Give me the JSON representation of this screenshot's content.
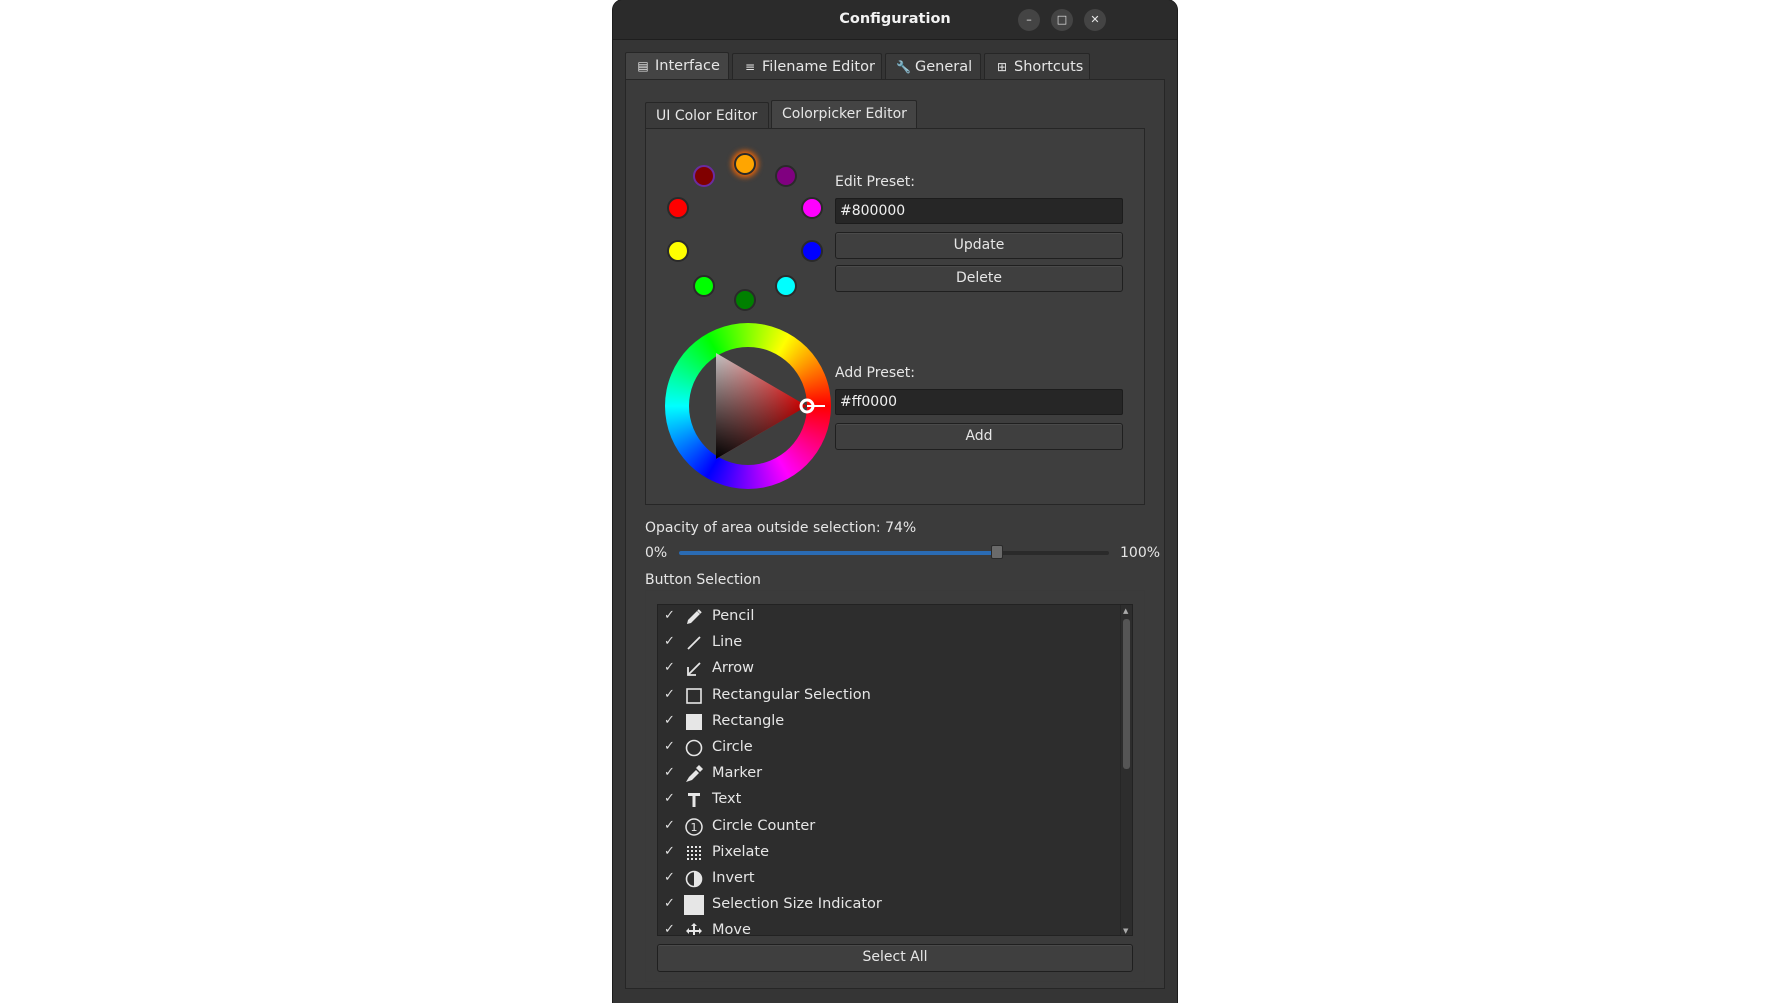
{
  "window": {
    "title": "Configuration",
    "controls": {
      "minimize": "–",
      "maximize": "□",
      "close": "✕"
    }
  },
  "tabs": [
    {
      "label": "Interface",
      "icon": "interface-icon",
      "active": true
    },
    {
      "label": "Filename Editor",
      "icon": "filename-icon",
      "active": false
    },
    {
      "label": "General",
      "icon": "wrench-icon",
      "active": false
    },
    {
      "label": "Shortcuts",
      "icon": "grid-icon",
      "active": false
    }
  ],
  "subtabs": [
    {
      "label": "UI Color Editor",
      "active": false
    },
    {
      "label": "Colorpicker Editor",
      "active": true
    }
  ],
  "colorpicker": {
    "presets": [
      "#ffa500",
      "#800080",
      "#ff00ff",
      "#0000ff",
      "#00ffff",
      "#008000",
      "#00ff00",
      "#ffff00",
      "#ff0000",
      "#800000"
    ],
    "selected_preset": "#800000",
    "edit_label": "Edit Preset:",
    "edit_value": "#800000",
    "update_label": "Update",
    "delete_label": "Delete",
    "add_label": "Add Preset:",
    "add_value": "#ff0000",
    "add_button": "Add"
  },
  "opacity": {
    "label": "Opacity of area outside selection: 74%",
    "min_label": "0%",
    "max_label": "100%",
    "value": 74
  },
  "button_selection": {
    "label": "Button Selection",
    "items": [
      {
        "label": "Pencil",
        "icon": "pencil-icon",
        "checked": true
      },
      {
        "label": "Line",
        "icon": "line-icon",
        "checked": true
      },
      {
        "label": "Arrow",
        "icon": "arrow-icon",
        "checked": true
      },
      {
        "label": "Rectangular Selection",
        "icon": "rect-selection-icon",
        "checked": true
      },
      {
        "label": "Rectangle",
        "icon": "rectangle-icon",
        "checked": true
      },
      {
        "label": "Circle",
        "icon": "circle-icon",
        "checked": true
      },
      {
        "label": "Marker",
        "icon": "marker-icon",
        "checked": true
      },
      {
        "label": "Text",
        "icon": "text-icon",
        "checked": true
      },
      {
        "label": "Circle Counter",
        "icon": "circle-counter-icon",
        "checked": true
      },
      {
        "label": "Pixelate",
        "icon": "pixelate-icon",
        "checked": true
      },
      {
        "label": "Invert",
        "icon": "invert-icon",
        "checked": true
      },
      {
        "label": "Selection Size Indicator",
        "icon": "size-indicator-icon",
        "checked": true
      },
      {
        "label": "Move",
        "icon": "move-icon",
        "checked": true
      }
    ],
    "check_glyph": "✓",
    "select_all_label": "Select All"
  }
}
